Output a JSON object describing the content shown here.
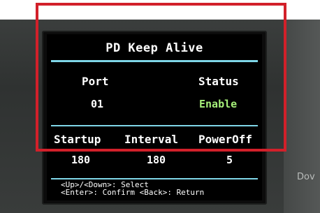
{
  "device": {
    "side_label": "Dov"
  },
  "screen": {
    "title": "PD Keep Alive",
    "port_label": "Port",
    "port_value": "01",
    "status_label": "Status",
    "status_value": "Enable",
    "startup_label": "Startup",
    "startup_value": "180",
    "interval_label": "Interval",
    "interval_value": "180",
    "poweroff_label": "PowerOff",
    "poweroff_value": "5",
    "hint_line1": "<Up>/<Down>: Select",
    "hint_line2": "<Enter>: Confirm  <Back>: Return"
  },
  "colors": {
    "status_enabled": "#a6f07a",
    "separator": "#7fd6e8",
    "highlight_frame": "#d2202a"
  }
}
